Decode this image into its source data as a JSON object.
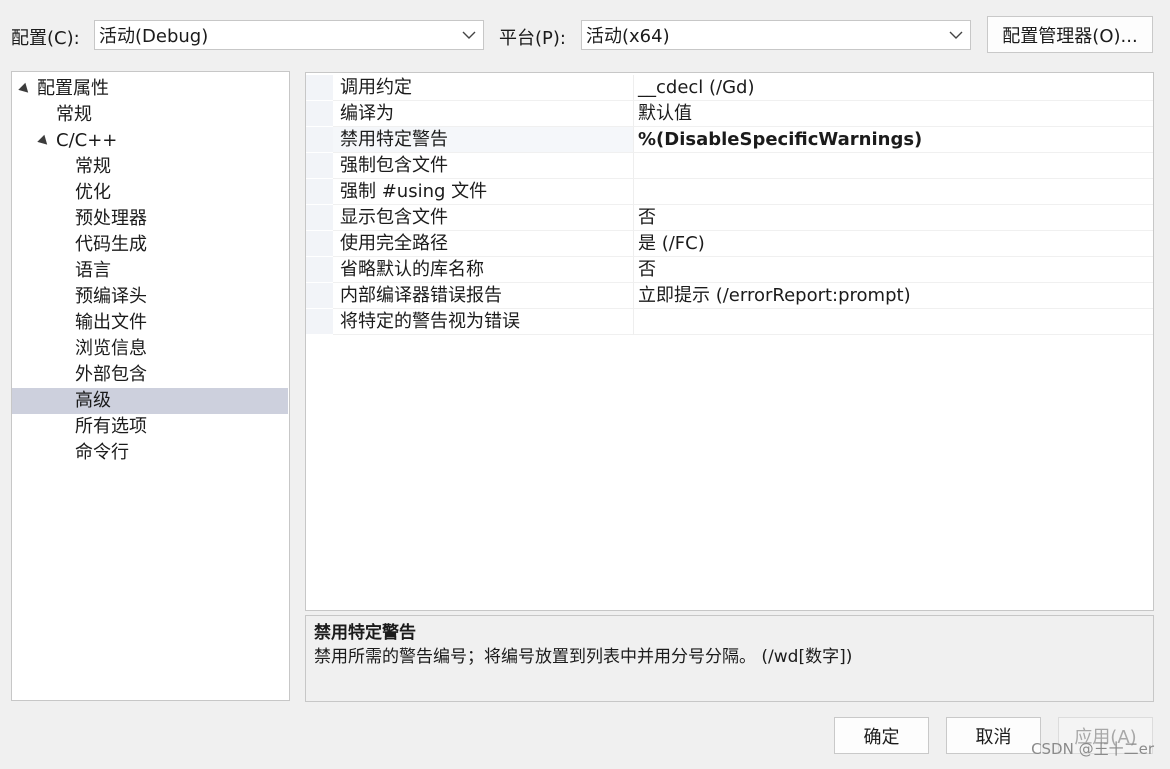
{
  "toolbar": {
    "config_label": "配置(C):",
    "config_value": "活动(Debug)",
    "platform_label": "平台(P):",
    "platform_value": "活动(x64)",
    "config_manager_button": "配置管理器(O)..."
  },
  "tree": {
    "items": [
      {
        "label": "配置属性",
        "level": 0,
        "expanded": true
      },
      {
        "label": "常规",
        "level": 1
      },
      {
        "label": "C/C++",
        "level": 1,
        "expanded": true
      },
      {
        "label": "常规",
        "level": 2
      },
      {
        "label": "优化",
        "level": 2
      },
      {
        "label": "预处理器",
        "level": 2
      },
      {
        "label": "代码生成",
        "level": 2
      },
      {
        "label": "语言",
        "level": 2
      },
      {
        "label": "预编译头",
        "level": 2
      },
      {
        "label": "输出文件",
        "level": 2
      },
      {
        "label": "浏览信息",
        "level": 2
      },
      {
        "label": "外部包含",
        "level": 2
      },
      {
        "label": "高级",
        "level": 2,
        "selected": true
      },
      {
        "label": "所有选项",
        "level": 2
      },
      {
        "label": "命令行",
        "level": 2
      }
    ]
  },
  "grid": {
    "rows": [
      {
        "name": "调用约定",
        "value": "__cdecl (/Gd)"
      },
      {
        "name": "编译为",
        "value": "默认值"
      },
      {
        "name": "禁用特定警告",
        "value": "%(DisableSpecificWarnings)",
        "bold": true,
        "selected": true
      },
      {
        "name": "强制包含文件",
        "value": ""
      },
      {
        "name": "强制 #using 文件",
        "value": ""
      },
      {
        "name": "显示包含文件",
        "value": "否"
      },
      {
        "name": "使用完全路径",
        "value": "是 (/FC)"
      },
      {
        "name": "省略默认的库名称",
        "value": "否"
      },
      {
        "name": "内部编译器错误报告",
        "value": "立即提示 (/errorReport:prompt)"
      },
      {
        "name": "将特定的警告视为错误",
        "value": ""
      }
    ]
  },
  "description": {
    "title": "禁用特定警告",
    "text": "禁用所需的警告编号；将编号放置到列表中并用分号分隔。    (/wd[数字])"
  },
  "buttons": {
    "ok": "确定",
    "cancel": "取消",
    "apply": "应用(A)"
  },
  "watermark": "CSDN @王十二er",
  "colors": {
    "window_bg": "#f0f0f0",
    "selection": "#cdd0dd",
    "border": "#c7c7c7"
  },
  "icons": [
    "chevron-down-icon",
    "tree-expanded-arrow-icon"
  ]
}
